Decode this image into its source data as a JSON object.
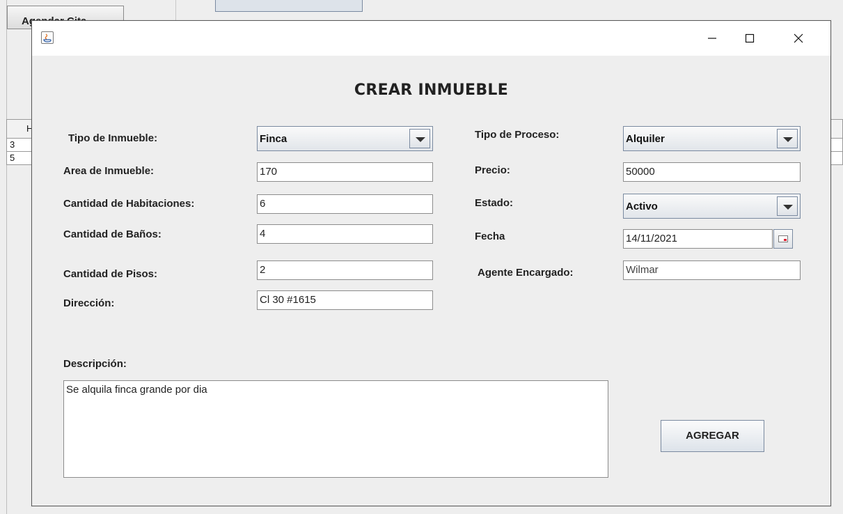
{
  "background": {
    "button_label": "Agendar Cita",
    "table_header": "H",
    "rows": [
      "3",
      "5"
    ]
  },
  "dialog": {
    "title": "",
    "heading": "CREAR INMUEBLE",
    "left": {
      "tipo_inmueble_label": "Tipo de Inmueble:",
      "tipo_inmueble_value": "Finca",
      "area_label": "Area de Inmueble:",
      "area_value": "170",
      "habitaciones_label": "Cantidad de Habitaciones:",
      "habitaciones_value": "6",
      "banos_label": "Cantidad de Baños:",
      "banos_value": "4",
      "pisos_label": "Cantidad de Pisos:",
      "pisos_value": "2",
      "direccion_label": "Dirección:",
      "direccion_value": "Cl 30 #1615"
    },
    "right": {
      "tipo_proceso_label": "Tipo de Proceso:",
      "tipo_proceso_value": "Alquiler",
      "precio_label": "Precio:",
      "precio_value": "50000",
      "estado_label": "Estado:",
      "estado_value": "Activo",
      "fecha_label": "Fecha",
      "fecha_value": "14/11/2021",
      "agente_label": "Agente Encargado:",
      "agente_value": "Wilmar"
    },
    "descripcion_label": "Descripción:",
    "descripcion_value": "Se alquila finca grande por dia",
    "agregar_label": "AGREGAR",
    "window_controls": [
      "minimize-icon",
      "maximize-icon",
      "close-icon"
    ]
  }
}
